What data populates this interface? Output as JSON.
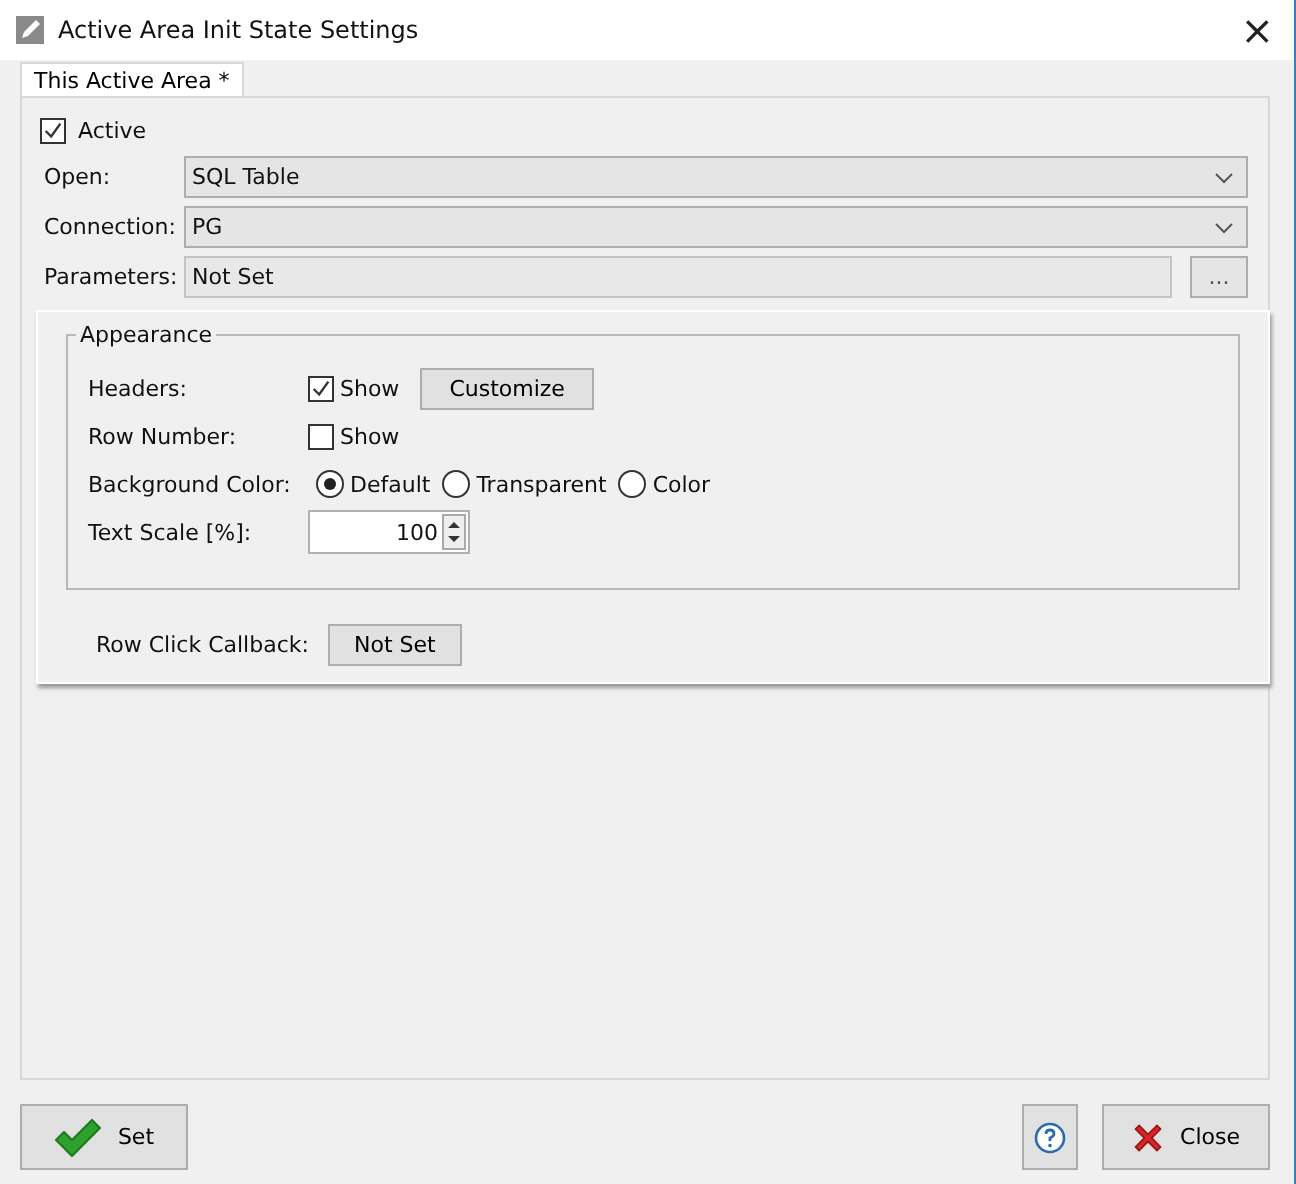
{
  "window": {
    "title": "Active Area Init State Settings",
    "close": "×"
  },
  "tabs": [
    {
      "label": "This Active Area *",
      "selected": true
    }
  ],
  "active": {
    "label": "Active",
    "checked": true
  },
  "fields": [
    {
      "kind": "dropdown",
      "label": "Open:",
      "value": "SQL Table"
    },
    {
      "kind": "dropdown",
      "label": "Connection:",
      "value": "PG"
    },
    {
      "kind": "text",
      "label": "Parameters:",
      "value": "Not Set",
      "button": "..."
    }
  ],
  "appearance": {
    "title": "Appearance",
    "rows": [
      {
        "kind": "checkbox",
        "label": "Headers:",
        "text": "Show",
        "checked": true,
        "button": "Customize"
      },
      {
        "kind": "checkbox",
        "label": "Row Number:",
        "text": "Show",
        "checked": false
      },
      {
        "kind": "radio",
        "label": "Background Color:",
        "options": [
          {
            "label": "Default",
            "selected": true
          },
          {
            "label": "Transparent",
            "selected": false
          },
          {
            "label": "Color",
            "selected": false
          }
        ]
      },
      {
        "kind": "spin",
        "label": "Text Scale [%]:",
        "value": "100"
      }
    ]
  },
  "callback": {
    "label": "Row Click Callback:",
    "button": "Not Set"
  },
  "buttons": [
    {
      "kind": "set",
      "label": "Set"
    },
    {
      "kind": "help"
    },
    {
      "kind": "close",
      "label": "Close"
    }
  ]
}
